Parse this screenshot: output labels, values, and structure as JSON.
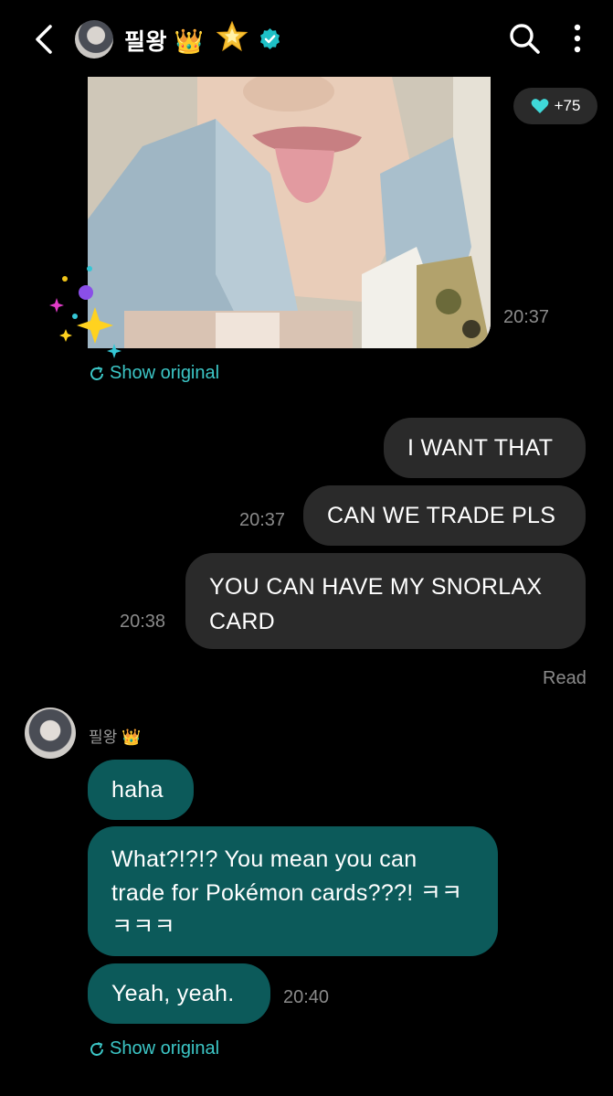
{
  "header": {
    "contact_name": "필왕",
    "crown_emoji": "👑",
    "star_emoji": "🌟",
    "icons": [
      "back-chevron-icon",
      "search-icon",
      "more-vertical-icon",
      "verified-badge-icon"
    ]
  },
  "thread": {
    "photo_message": {
      "time": "20:37",
      "reaction_count": "+75",
      "reaction_icon": "heart-icon",
      "show_original": "Show original"
    },
    "outgoing": [
      {
        "text": "I WANT THAT",
        "time": ""
      },
      {
        "text": "CAN WE TRADE PLS",
        "time": "20:37"
      },
      {
        "text": "YOU CAN HAVE MY SNORLAX CARD",
        "time": "20:38"
      }
    ],
    "read_receipt": "Read",
    "incoming": {
      "sender": "필왕",
      "sender_crown": "👑",
      "messages": [
        {
          "text": "haha",
          "time": ""
        },
        {
          "text": "What?!?!? You mean you can trade for Pokémon cards???! ㅋㅋㅋㅋㅋ",
          "time": ""
        },
        {
          "text": "Yeah, yeah.",
          "time": "20:40"
        }
      ],
      "show_original": "Show original"
    }
  },
  "colors": {
    "background": "#000000",
    "outgoing_bubble": "#2a2a2a",
    "incoming_bubble": "#0c5a5a",
    "accent": "#3cc7c7"
  }
}
